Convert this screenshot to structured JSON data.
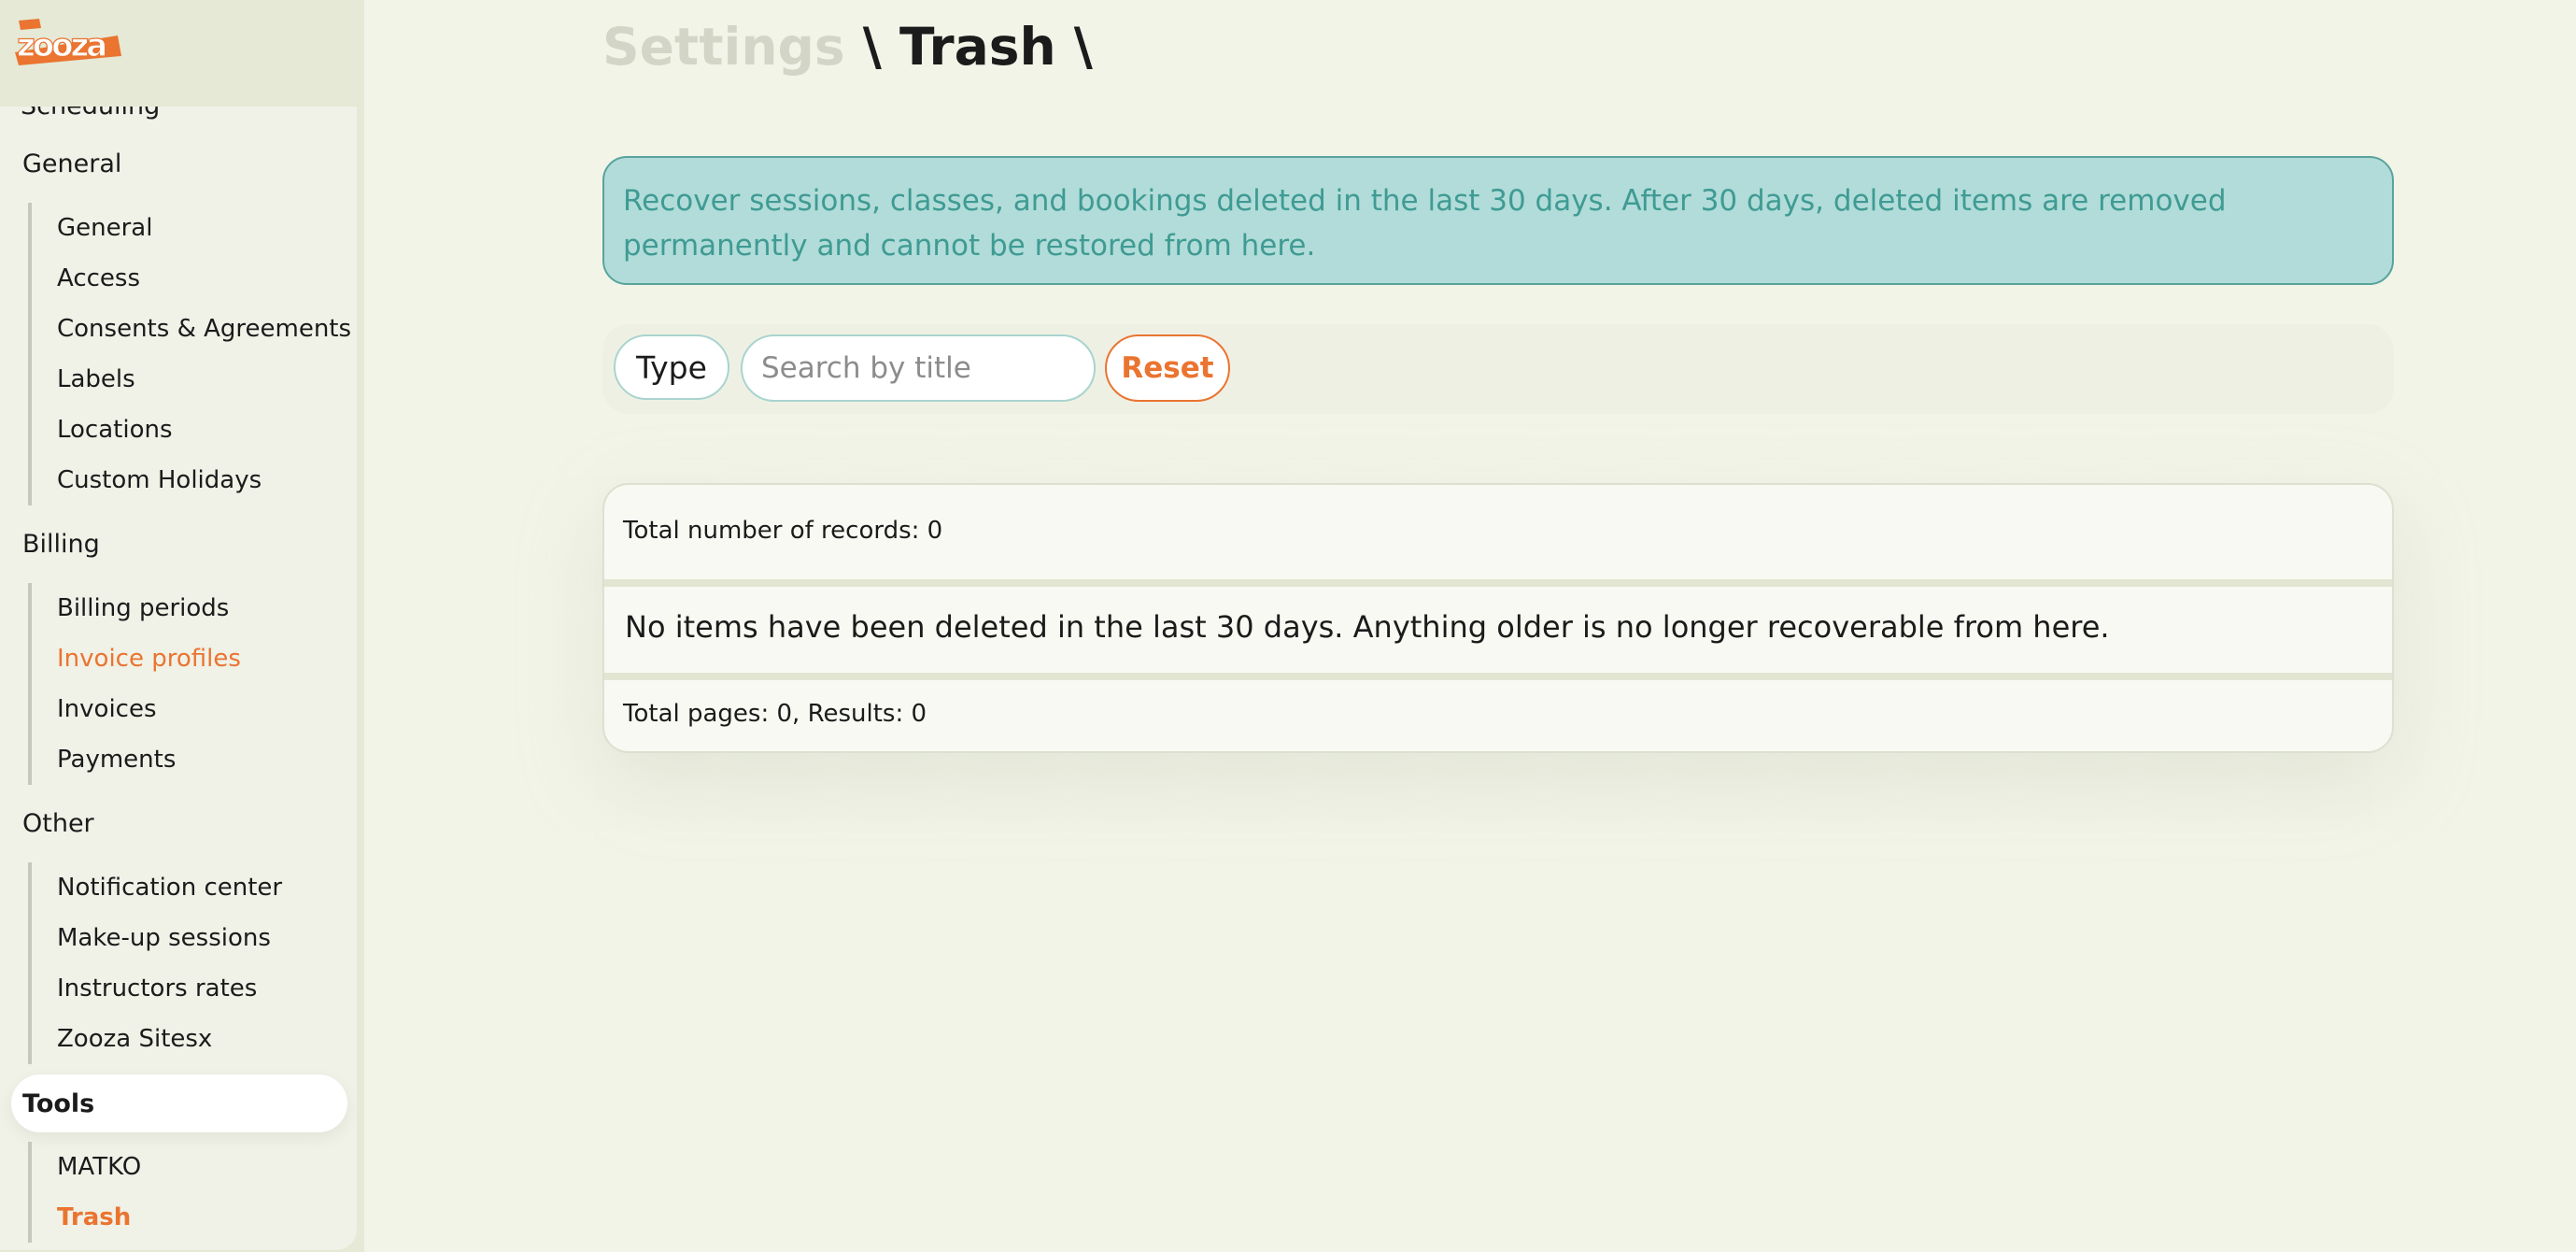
{
  "app": {
    "logo_text": "Zooza"
  },
  "breadcrumb": {
    "settings": "Settings",
    "sep1": "\\",
    "trash": "Trash",
    "sep2": "\\"
  },
  "sidebar": {
    "cut_item": "Scheduling",
    "groups": [
      {
        "label": "General",
        "items": [
          "General",
          "Access",
          "Consents & Agreements",
          "Labels",
          "Locations",
          "Custom Holidays"
        ]
      },
      {
        "label": "Billing",
        "items": [
          "Billing periods",
          "Invoice profiles",
          "Invoices",
          "Payments"
        ]
      },
      {
        "label": "Other",
        "items": [
          "Notification center",
          "Make-up sessions",
          "Instructors rates",
          "Zooza Sitesx"
        ]
      },
      {
        "label": "Tools",
        "items": [
          "MATKO",
          "Trash"
        ]
      }
    ]
  },
  "info": {
    "text": "Recover sessions, classes, and bookings deleted in the last 30 days. After 30 days, deleted items are removed permanently and cannot be restored from here."
  },
  "filters": {
    "type_label": "Type",
    "search_placeholder": "Search by title",
    "search_value": "",
    "reset_label": "Reset"
  },
  "records": {
    "total_text": "Total number of records: 0",
    "empty_text": "No items have been deleted in the last 30 days. Anything older is no longer recoverable from here.",
    "pages_text": "Total pages: 0, Results: 0"
  },
  "colors": {
    "accent": "#ea7430",
    "info_bg": "#b1dcd9",
    "info_text": "#3f9b93",
    "page_bg": "#f2f4e8"
  }
}
